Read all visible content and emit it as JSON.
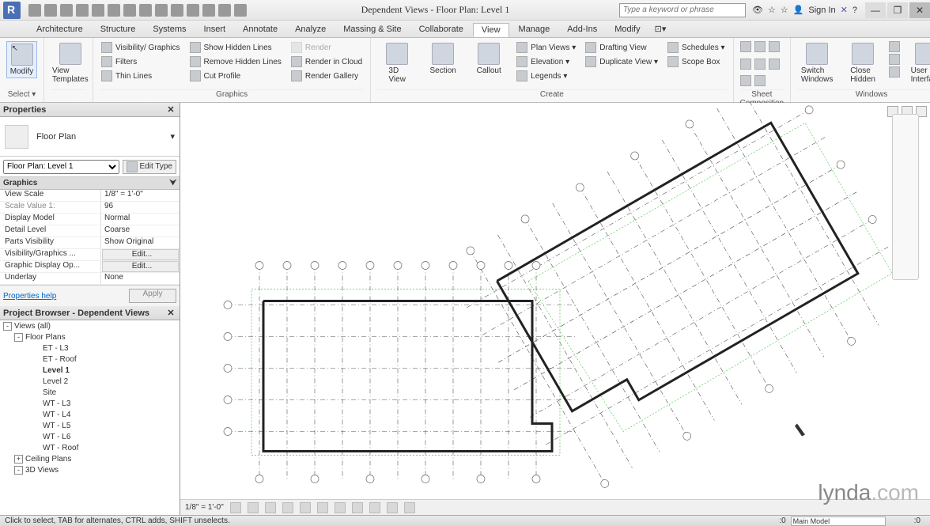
{
  "title": "Dependent Views - Floor Plan: Level 1",
  "search_placeholder": "Type a keyword or phrase",
  "signin": "Sign In",
  "menutabs": [
    "Architecture",
    "Structure",
    "Systems",
    "Insert",
    "Annotate",
    "Analyze",
    "Massing & Site",
    "Collaborate",
    "View",
    "Manage",
    "Add-Ins",
    "Modify"
  ],
  "active_tab": "View",
  "ribbon": {
    "select": {
      "modify": "Modify",
      "label": "Select ▾",
      "templates": "View\nTemplates"
    },
    "graphics": {
      "label": "Graphics",
      "items": [
        "Visibility/ Graphics",
        "Filters",
        "Thin  Lines",
        "Show  Hidden Lines",
        "Remove  Hidden Lines",
        "Cut  Profile",
        "Render",
        "Render  in Cloud",
        "Render  Gallery"
      ]
    },
    "create": {
      "label": "Create",
      "v3d": "3D\nView",
      "section": "Section",
      "callout": "Callout",
      "items": [
        "Plan  Views ▾",
        "Elevation ▾",
        "Legends ▾",
        "Drafting  View",
        "Duplicate  View ▾",
        "Schedules ▾",
        "Scope  Box"
      ]
    },
    "sheet": {
      "label": "Sheet Composition"
    },
    "windows": {
      "label": "Windows",
      "switch": "Switch\nWindows",
      "close": "Close\nHidden",
      "ui": "User\nInterface"
    }
  },
  "properties": {
    "title": "Properties",
    "type": "Floor Plan",
    "instance": "Floor Plan: Level 1",
    "edit_type": "Edit Type",
    "cat": "Graphics",
    "rows": [
      {
        "k": "View Scale",
        "v": "1/8\" = 1'-0\""
      },
      {
        "k": "Scale Value   1:",
        "v": "96",
        "dim": true
      },
      {
        "k": "Display Model",
        "v": "Normal"
      },
      {
        "k": "Detail Level",
        "v": "Coarse"
      },
      {
        "k": "Parts Visibility",
        "v": "Show Original"
      },
      {
        "k": "Visibility/Graphics ...",
        "v": "Edit...",
        "btn": true
      },
      {
        "k": "Graphic Display Op...",
        "v": "Edit...",
        "btn": true
      },
      {
        "k": "Underlay",
        "v": "None",
        "dim": false
      }
    ],
    "help": "Properties help",
    "apply": "Apply"
  },
  "browser": {
    "title": "Project Browser - Dependent Views",
    "root": "Views (all)",
    "floorplans": "Floor Plans",
    "items": [
      "ET - L3",
      "ET - Roof",
      "Level 1",
      "Level 2",
      "Site",
      "WT - L3",
      "WT - L4",
      "WT - L5",
      "WT - L6",
      "WT - Roof"
    ],
    "ceiling": "Ceiling Plans",
    "views3d": "3D Views",
    "bold": "Level 1"
  },
  "viewbar": {
    "scale": "1/8\" = 1'-0\""
  },
  "statusbar": {
    "hint": "Click to select, TAB for alternates, CTRL adds, SHIFT unselects.",
    "stat": ":0",
    "model": "Main Model"
  },
  "watermark": {
    "a": "lynda",
    "b": ".com"
  }
}
